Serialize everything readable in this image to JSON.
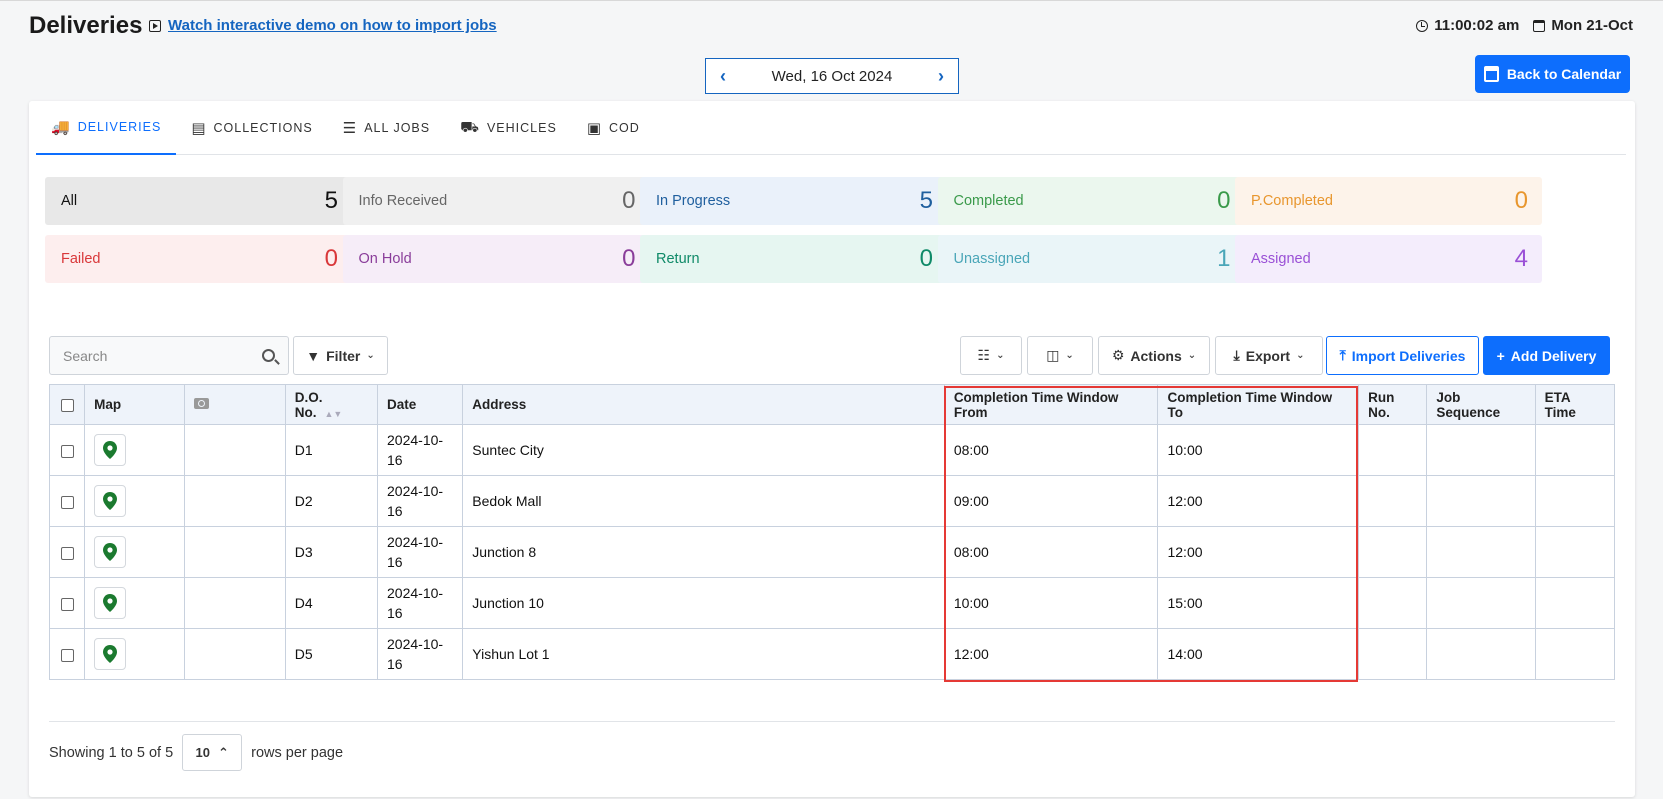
{
  "header": {
    "title": "Deliveries",
    "demo_link": "Watch interactive demo on how to import jobs",
    "time": "11:00:02 am",
    "date": "Mon 21-Oct"
  },
  "date_nav": {
    "label": "Wed, 16 Oct 2024"
  },
  "back_button": "Back to Calendar",
  "tabs": [
    {
      "label": "DELIVERIES",
      "icon": "truck-icon",
      "active": true
    },
    {
      "label": "COLLECTIONS",
      "icon": "archive-icon"
    },
    {
      "label": "ALL JOBS",
      "icon": "list-icon"
    },
    {
      "label": "VEHICLES",
      "icon": "car-icon"
    },
    {
      "label": "COD",
      "icon": "money-icon"
    }
  ],
  "stats": [
    {
      "label": "All",
      "value": "5",
      "bg": "#e8e8e8",
      "color": "#111"
    },
    {
      "label": "Info Received",
      "value": "0",
      "bg": "#f0f0f0",
      "color": "#666"
    },
    {
      "label": "In Progress",
      "value": "5",
      "bg": "#eaf1fa",
      "color": "#1f5f9e"
    },
    {
      "label": "Completed",
      "value": "0",
      "bg": "#ebf7ee",
      "color": "#3a9a4a"
    },
    {
      "label": "P.Completed",
      "value": "0",
      "bg": "#fdf3ea",
      "color": "#e8962e"
    },
    {
      "label": "Failed",
      "value": "0",
      "bg": "#fdeeee",
      "color": "#d9383a"
    },
    {
      "label": "On Hold",
      "value": "0",
      "bg": "#f6edf8",
      "color": "#8a3d9a"
    },
    {
      "label": "Return",
      "value": "0",
      "bg": "#e6f6f1",
      "color": "#0f8a68"
    },
    {
      "label": "Unassigned",
      "value": "1",
      "bg": "#eaf5f8",
      "color": "#4aa6b8"
    },
    {
      "label": "Assigned",
      "value": "4",
      "bg": "#f4edfc",
      "color": "#9a50d6"
    }
  ],
  "toolbar": {
    "search_placeholder": "Search",
    "filter": "Filter",
    "actions": "Actions",
    "export": "Export",
    "import": "Import Deliveries",
    "add": "Add Delivery"
  },
  "table": {
    "columns": [
      "Map",
      "D.O. No.",
      "Date",
      "Address",
      "Completion Time Window From",
      "Completion Time Window To",
      "Run No.",
      "Job Sequence",
      "ETA Time"
    ],
    "rows": [
      {
        "do": "D1",
        "date": "2024-10-16",
        "address": "Suntec City",
        "from": "08:00",
        "to": "10:00"
      },
      {
        "do": "D2",
        "date": "2024-10-16",
        "address": "Bedok Mall",
        "from": "09:00",
        "to": "12:00"
      },
      {
        "do": "D3",
        "date": "2024-10-16",
        "address": "Junction 8",
        "from": "08:00",
        "to": "12:00"
      },
      {
        "do": "D4",
        "date": "2024-10-16",
        "address": "Junction 10",
        "from": "10:00",
        "to": "15:00"
      },
      {
        "do": "D5",
        "date": "2024-10-16",
        "address": "Yishun Lot 1",
        "from": "12:00",
        "to": "14:00"
      }
    ]
  },
  "footer": {
    "showing": "Showing 1 to 5 of 5",
    "rows_value": "10",
    "rows_label": "rows per page"
  },
  "colors": {
    "primary": "#0d6efd",
    "pin": "#1b7a2f",
    "highlight": "#e53935"
  }
}
